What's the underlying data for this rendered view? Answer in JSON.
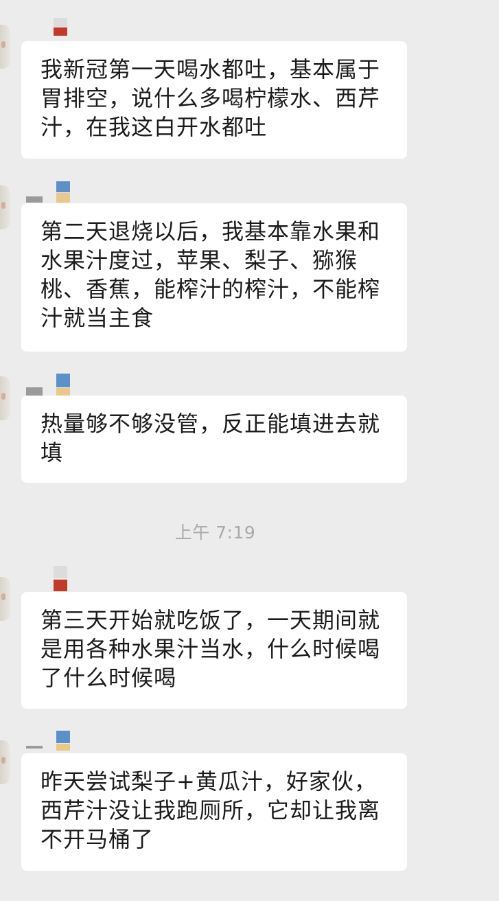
{
  "messages": [
    {
      "text": "我新冠第一天喝水都吐，基本属于胃排空，说什么多喝柠檬水、西芹汁，在我这白开水都吐"
    },
    {
      "text": "第二天退烧以后，我基本靠水果和水果汁度过，苹果、梨子、猕猴桃、香蕉，能榨汁的榨汁，不能榨汁就当主食"
    },
    {
      "text": "热量够不够没管，反正能填进去就填"
    },
    {
      "text": "第三天开始就吃饭了，一天期间就是用各种水果汁当水，什么时候喝了什么时候喝"
    },
    {
      "text": "昨天尝试梨子+黄瓜汁，好家伙，西芹汁没让我跑厕所，它却让我离不开马桶了"
    }
  ],
  "timestamp": "上午 7:19",
  "colors": {
    "background": "#ececec",
    "bubble": "#ffffff",
    "text": "#1b1b1b",
    "timestamp": "#a9a9a9"
  }
}
